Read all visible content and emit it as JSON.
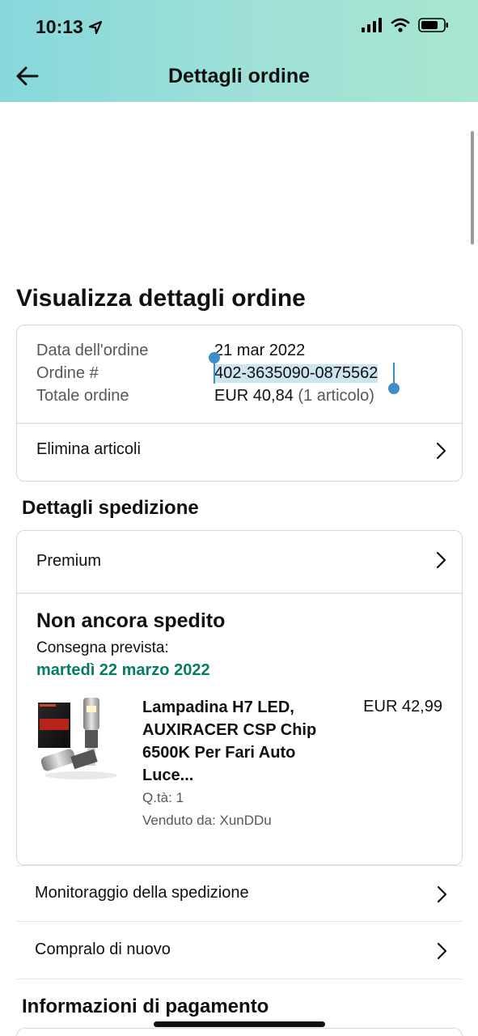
{
  "status_bar": {
    "time": "10:13",
    "icons": [
      "location-arrow-icon",
      "cellular-signal-icon",
      "wifi-icon",
      "battery-icon"
    ]
  },
  "header": {
    "title": "Dettagli ordine",
    "back_icon": "back-arrow-icon"
  },
  "main": {
    "title": "Visualizza dettagli ordine",
    "order_summary": {
      "rows": [
        {
          "label": "Data dell'ordine",
          "value": "21 mar 2022"
        },
        {
          "label": "Ordine #",
          "value": "402-3635090-0875562"
        },
        {
          "label": "Totale ordine",
          "value": "EUR 40,84",
          "extra": " (1 articolo)"
        }
      ],
      "action": "Elimina articoli"
    },
    "shipping": {
      "section_title": "Dettagli spedizione",
      "method": "Premium",
      "status": "Non ancora spedito",
      "delivery_label": "Consegna prevista:",
      "delivery_date": "martedì 22 marzo 2022",
      "item": {
        "name_lines": [
          "Lampadina H7 LED,",
          "AUXIRACER CSP Chip",
          "6500K Per Fari Auto",
          "Luce..."
        ],
        "price": "EUR 42,99",
        "quantity": "Q.tà: 1",
        "seller": "Venduto da: XunDDu"
      }
    },
    "actions": [
      {
        "label": "Monitoraggio della spedizione"
      },
      {
        "label": "Compralo di nuovo"
      }
    ],
    "payment": {
      "section_title": "Informazioni di pagamento"
    }
  },
  "colors": {
    "header_gradient_start": "#86d8dc",
    "header_gradient_end": "#a8e6cf",
    "delivery_green": "#067d62",
    "selection_handle": "#3d8fc6",
    "selection_highlight": "#cfe4f1"
  }
}
